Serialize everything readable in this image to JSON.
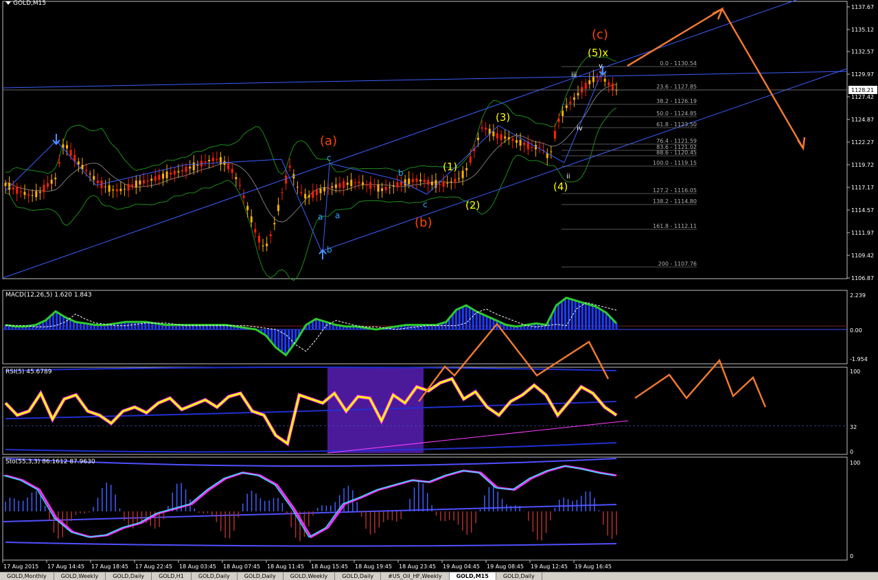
{
  "header": {
    "symbol": "GOLD,M15"
  },
  "indicators": {
    "macd": "MACD(12,26,5) 1.620 1.843",
    "rsi": "RSI(5) 45.6789",
    "sto": "Sto(55,3,3) 86.1612 87.9630"
  },
  "price_axis": [
    "1137.67",
    "1135.12",
    "1132.57",
    "1129.97",
    "1127.42",
    "1124.87",
    "1122.27",
    "1119.72",
    "1117.17",
    "1114.57",
    "1111.97",
    "1109.42",
    "1106.87"
  ],
  "current_price": "1128.21",
  "macd_axis": [
    "2.239",
    "0.00",
    "-1.954"
  ],
  "rsi_axis": [
    "100",
    "32",
    "0"
  ],
  "sto_axis": [
    "100",
    "0"
  ],
  "time_axis": [
    "17 Aug 2015",
    "17 Aug 14:45",
    "17 Aug 18:45",
    "17 Aug 22:45",
    "18 Aug 03:45",
    "18 Aug 07:45",
    "18 Aug 11:45",
    "18 Aug 15:45",
    "18 Aug 19:45",
    "18 Aug 23:45",
    "19 Aug 04:45",
    "19 Aug 08:45",
    "19 Aug 12:45",
    "19 Aug 16:45"
  ],
  "fib_levels": [
    "0.0 - 1130.54",
    "23.6 - 1127.85",
    "38.2 - 1126.19",
    "50.0 - 1124.85",
    "61.8 - 1123.50",
    "76.4 - 1121.59",
    "83.6 - 1121.02",
    "88.6 - 1120.45",
    "100.0 - 1119.15",
    "127.2 - 1116.05",
    "138.2 - 1114.80",
    "161.8 - 1112.11",
    "200 - 1107.76"
  ],
  "wave_labels": {
    "a_major": "(a)",
    "b_major": "(b)",
    "c_major": "(c)",
    "w1": "(1)",
    "w2": "(2)",
    "w3": "(3)",
    "w4": "(4)",
    "w5x": "(5)x",
    "sub_a1": "a",
    "sub_a2": "a",
    "sub_b1": "b",
    "sub_b2": "b",
    "sub_c1": "c",
    "sub_c2": "c",
    "r_iii": "iii",
    "r_iv": "iv",
    "r_ii": "ii",
    "r_v": "v"
  },
  "tabs": [
    "GOLD,Monthly",
    "GOLD,Weekly",
    "GOLD,Daily",
    "GOLD,H1",
    "GOLD,Daily",
    "GOLD,Daily",
    "GOLD,Weekly",
    "GOLD,Daily",
    "#US_Oil_HF,Weekly",
    "GOLD,M15",
    "GOLD,Daily"
  ],
  "active_tab": 9,
  "colors": {
    "bull": "#ffb000",
    "bear": "#ff2000",
    "orange": "#f07830",
    "yellow": "#ffff00",
    "wave_red": "#ff4500",
    "blue_line": "#3a5fff",
    "green": "#2ecc2e",
    "bands": "#1c8c1c"
  },
  "chart_data": {
    "type": "candlestick",
    "title": "GOLD,M15",
    "price_range": [
      1106.87,
      1137.67
    ],
    "current_price": 1128.21,
    "close_path": [
      1117.5,
      1117.0,
      1116.6,
      1116.2,
      1116.5,
      1117.4,
      1118.2,
      1122.3,
      1120.8,
      1119.6,
      1118.8,
      1117.8,
      1117.2,
      1116.8,
      1116.9,
      1117.3,
      1117.7,
      1117.9,
      1118.2,
      1118.5,
      1118.8,
      1119.0,
      1119.4,
      1119.7,
      1120.1,
      1120.4,
      1120.1,
      1119.2,
      1117.4,
      1114.6,
      1111.8,
      1110.1,
      1112.5,
      1116.4,
      1119.6,
      1116.9,
      1116.0,
      1116.5,
      1116.9,
      1117.2,
      1117.4,
      1117.6,
      1117.8,
      1117.5,
      1117.3,
      1116.9,
      1117.2,
      1117.5,
      1117.8,
      1118.0,
      1117.9,
      1117.6,
      1117.5,
      1117.7,
      1118.0,
      1119.0,
      1121.4,
      1124.1,
      1123.4,
      1122.9,
      1122.8,
      1122.4,
      1122.1,
      1121.7,
      1121.8,
      1120.4,
      1124.6,
      1126.3,
      1127.3,
      1128.4,
      1129.3,
      1129.9,
      1129.0,
      1128.2
    ],
    "macd_values": [
      0.3,
      0.2,
      0.2,
      0.3,
      0.6,
      1.2,
      0.8,
      0.5,
      0.4,
      0.3,
      0.3,
      0.4,
      0.5,
      0.5,
      0.5,
      0.4,
      0.3,
      0.3,
      0.3,
      0.3,
      0.3,
      0.3,
      0.3,
      0.2,
      0.1,
      0.0,
      -0.4,
      -1.2,
      -1.7,
      -0.8,
      0.3,
      0.7,
      0.5,
      0.3,
      0.2,
      0.2,
      0.1,
      0.0,
      0.1,
      0.2,
      0.3,
      0.3,
      0.3,
      0.3,
      0.5,
      1.3,
      1.6,
      1.2,
      0.9,
      0.6,
      0.3,
      0.2,
      0.3,
      0.4,
      0.3,
      1.6,
      2.1,
      1.9,
      1.7,
      1.5,
      1.1,
      0.4
    ],
    "rsi_values": [
      60,
      45,
      50,
      72,
      40,
      65,
      70,
      50,
      45,
      35,
      50,
      55,
      48,
      60,
      66,
      52,
      58,
      64,
      55,
      68,
      72,
      50,
      45,
      20,
      10,
      70,
      65,
      60,
      72,
      50,
      68,
      66,
      38,
      70,
      60,
      80,
      75,
      85,
      90,
      65,
      74,
      55,
      45,
      62,
      70,
      82,
      70,
      45,
      62,
      80,
      72,
      55,
      45
    ],
    "sto_values": [
      85,
      80,
      70,
      40,
      25,
      20,
      22,
      30,
      35,
      45,
      50,
      55,
      70,
      82,
      88,
      85,
      75,
      50,
      20,
      30,
      55,
      62,
      70,
      75,
      80,
      78,
      85,
      90,
      88,
      72,
      70,
      82,
      90,
      95,
      92,
      88,
      85
    ],
    "projection_price": [
      1129.5,
      1136.2,
      1120.2
    ],
    "rsi_projection": [
      78,
      95,
      80,
      95,
      70,
      98,
      80,
      88,
      58
    ]
  }
}
